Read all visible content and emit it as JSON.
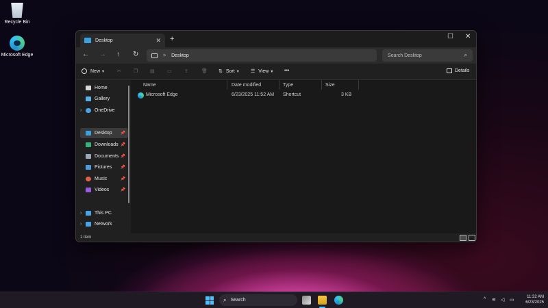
{
  "desktop": {
    "icons": [
      {
        "label": "Recycle Bin"
      },
      {
        "label": "Microsoft Edge"
      }
    ]
  },
  "window": {
    "tab_title": "Desktop",
    "tab_close": "✕",
    "new_tab": "+",
    "maximize": "☐",
    "close": "✕",
    "nav": {
      "back": "←",
      "forward": "→",
      "up": "↑",
      "refresh": "↻"
    },
    "path_separator": ">",
    "path": "Desktop",
    "search_placeholder": "Search Desktop",
    "search_icon": "⌕"
  },
  "commandbar": {
    "new_label": "New",
    "sort_label": "Sort",
    "view_label": "View",
    "more_label": "•••",
    "details_label": "Details"
  },
  "sidebar": {
    "items": [
      {
        "label": "Home",
        "color": "#d8d8d8"
      },
      {
        "label": "Gallery",
        "color": "#5bb0e8"
      },
      {
        "label": "OneDrive",
        "color": "#4aa3e6"
      },
      {
        "label": "Desktop",
        "color": "#3aa0e0"
      },
      {
        "label": "Downloads",
        "color": "#35b37e"
      },
      {
        "label": "Documents",
        "color": "#9aa8b8"
      },
      {
        "label": "Pictures",
        "color": "#4a9be0"
      },
      {
        "label": "Music",
        "color": "#e0604a"
      },
      {
        "label": "Videos",
        "color": "#9a5ae0"
      },
      {
        "label": "This PC",
        "color": "#4aa3e6"
      },
      {
        "label": "Network",
        "color": "#4aa3e6"
      }
    ]
  },
  "files": {
    "columns": [
      "Name",
      "Date modified",
      "Type",
      "Size"
    ],
    "rows": [
      {
        "name": "Microsoft Edge",
        "date": "6/23/2025 11:52 AM",
        "type": "Shortcut",
        "size": "3 KB"
      }
    ]
  },
  "statusbar": {
    "count": "1 item"
  },
  "taskbar": {
    "search_label": "Search",
    "time": "11:32 AM",
    "date": "6/23/2025"
  }
}
